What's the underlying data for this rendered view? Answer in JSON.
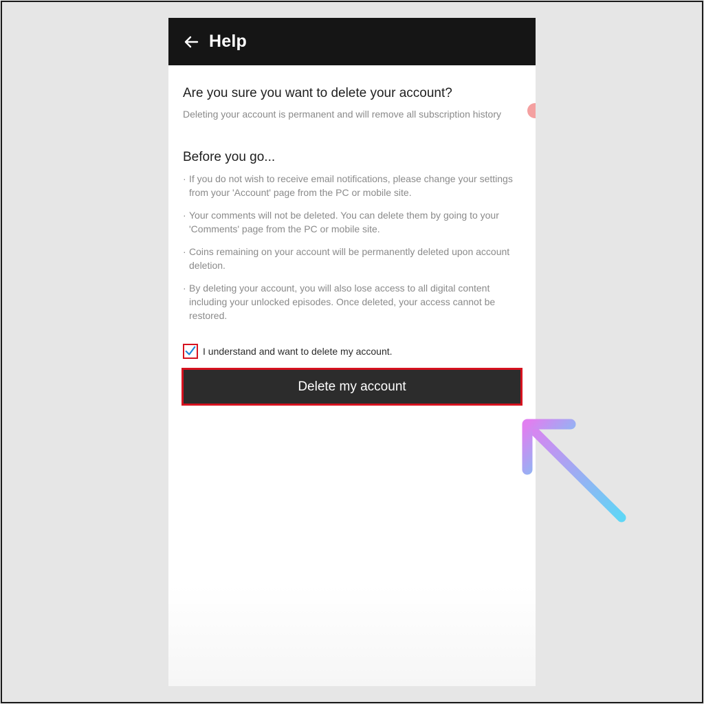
{
  "app_bar": {
    "title": "Help",
    "back_icon": "arrow-left-icon"
  },
  "confirmation": {
    "question": "Are you sure you want to delete your account?",
    "subtitle": "Deleting your account is permanent and will remove all subscription history"
  },
  "before_you_go": {
    "title": "Before you go...",
    "items": [
      "If you do not wish to receive email notifications, please change your settings from your 'Account' page from the PC or mobile site.",
      "Your comments will not be deleted. You can delete them by going to your 'Comments' page from the PC or mobile site.",
      "Coins remaining on your account will be permanently deleted upon account deletion.",
      "By deleting your account, you will also lose access to all digital content including your unlocked episodes. Once deleted, your access cannot be restored."
    ]
  },
  "agreement": {
    "label": "I understand and want to delete my account.",
    "checked": true,
    "check_icon": "checkmark-icon"
  },
  "delete_button": {
    "label": "Delete my account"
  },
  "colors": {
    "app_bar": "#151515",
    "highlight_red": "#d6121f",
    "button_dark": "#2c2c2c",
    "checkmark": "#1e88d8",
    "arrow_start": "#e07ff0",
    "arrow_end": "#5fd6f6"
  }
}
